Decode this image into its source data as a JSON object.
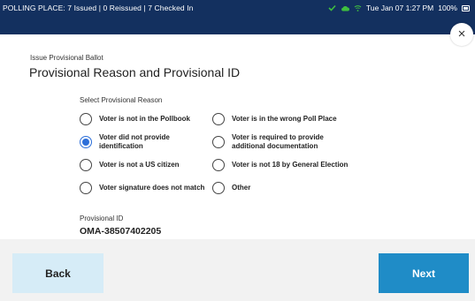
{
  "status_bar": {
    "polling_place": "POLLING PLACE: 7 Issued | 0 Reissued | 7 Checked In",
    "datetime": "Tue Jan 07 1:27 PM",
    "battery": "100%",
    "check_color": "#3fbf3f"
  },
  "header": {
    "close_glyph": "×",
    "subheading": "Issue Provisional Ballot",
    "title": "Provisional Reason and Provisional ID"
  },
  "reason": {
    "label": "Select Provisional Reason",
    "selected": "Voter did not provide identification",
    "options": [
      {
        "line1": "Voter is not in the Pollbook",
        "line2": ""
      },
      {
        "line1": "Voter is in the wrong Poll Place",
        "line2": ""
      },
      {
        "line1": "Voter did not provide",
        "line2": "identification"
      },
      {
        "line1": "Voter is required to provide",
        "line2": "additional documentation"
      },
      {
        "line1": "Voter is not a US citizen",
        "line2": ""
      },
      {
        "line1": "Voter is not 18 by General Election",
        "line2": ""
      },
      {
        "line1": "Voter signature does not match",
        "line2": ""
      },
      {
        "line1": "Other",
        "line2": ""
      }
    ]
  },
  "provisional_id": {
    "label": "Provisional ID",
    "value": "OMA-38507402205"
  },
  "footer": {
    "back_label": "Back",
    "next_label": "Next",
    "accent": "#1f8cc7"
  }
}
